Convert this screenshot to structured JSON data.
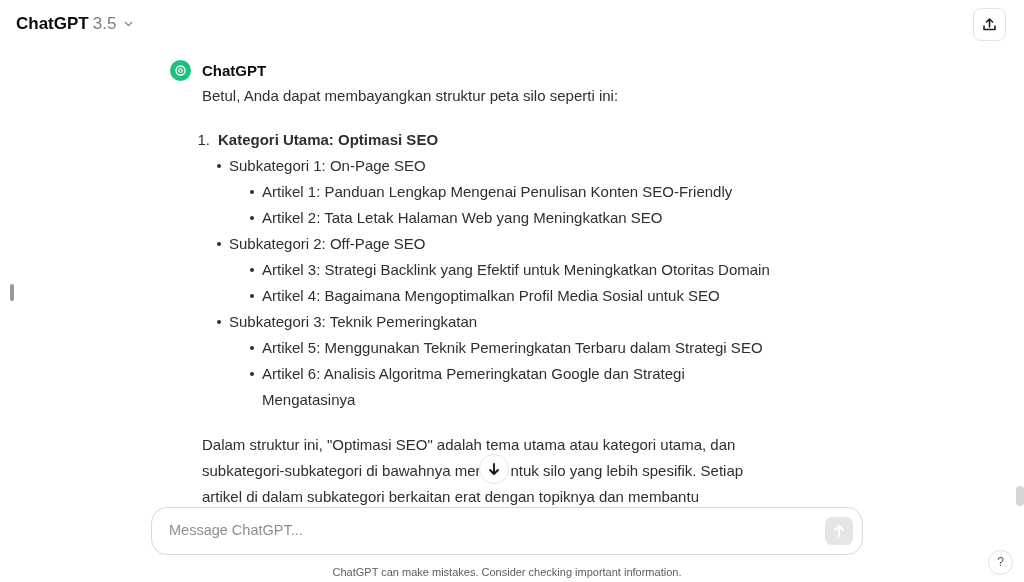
{
  "header": {
    "title": "ChatGPT",
    "version": "3.5"
  },
  "message": {
    "author": "ChatGPT",
    "intro": "Betul, Anda dapat membayangkan struktur peta silo seperti ini:",
    "outline": [
      {
        "marker": "1.",
        "label": "Kategori Utama: Optimasi SEO",
        "children": [
          {
            "label": "Subkategori 1: On-Page SEO",
            "children": [
              {
                "label": "Artikel 1: Panduan Lengkap Mengenai Penulisan Konten SEO-Friendly"
              },
              {
                "label": "Artikel 2: Tata Letak Halaman Web yang Meningkatkan SEO"
              }
            ]
          },
          {
            "label": "Subkategori 2: Off-Page SEO",
            "children": [
              {
                "label": "Artikel 3: Strategi Backlink yang Efektif untuk Meningkatkan Otoritas Domain"
              },
              {
                "label": "Artikel 4: Bagaimana Mengoptimalkan Profil Media Sosial untuk SEO"
              }
            ]
          },
          {
            "label": "Subkategori 3: Teknik Pemeringkatan",
            "children": [
              {
                "label": "Artikel 5: Menggunakan Teknik Pemeringkatan Terbaru dalam Strategi SEO"
              },
              {
                "label": "Artikel 6: Analisis Algoritma Pemeringkatan Google dan Strategi Mengatasinya"
              }
            ]
          }
        ]
      }
    ],
    "paragraph_lines": [
      [
        "Dalam struktur ini, \"Optimasi SEO\" adalah tema utama atau kategori utama, dan"
      ],
      [
        "subkategori-subkategori di bawahnya mer",
        "ntuk silo yang lebih spesifik. Setiap"
      ],
      [
        "artikel di dalam subkategori berkaitan erat dengan topiknya dan membantu"
      ]
    ]
  },
  "composer": {
    "placeholder": "Message ChatGPT...",
    "send_disabled": true
  },
  "disclaimer": "ChatGPT can make mistakes. Consider checking important information.",
  "help_button": "?"
}
